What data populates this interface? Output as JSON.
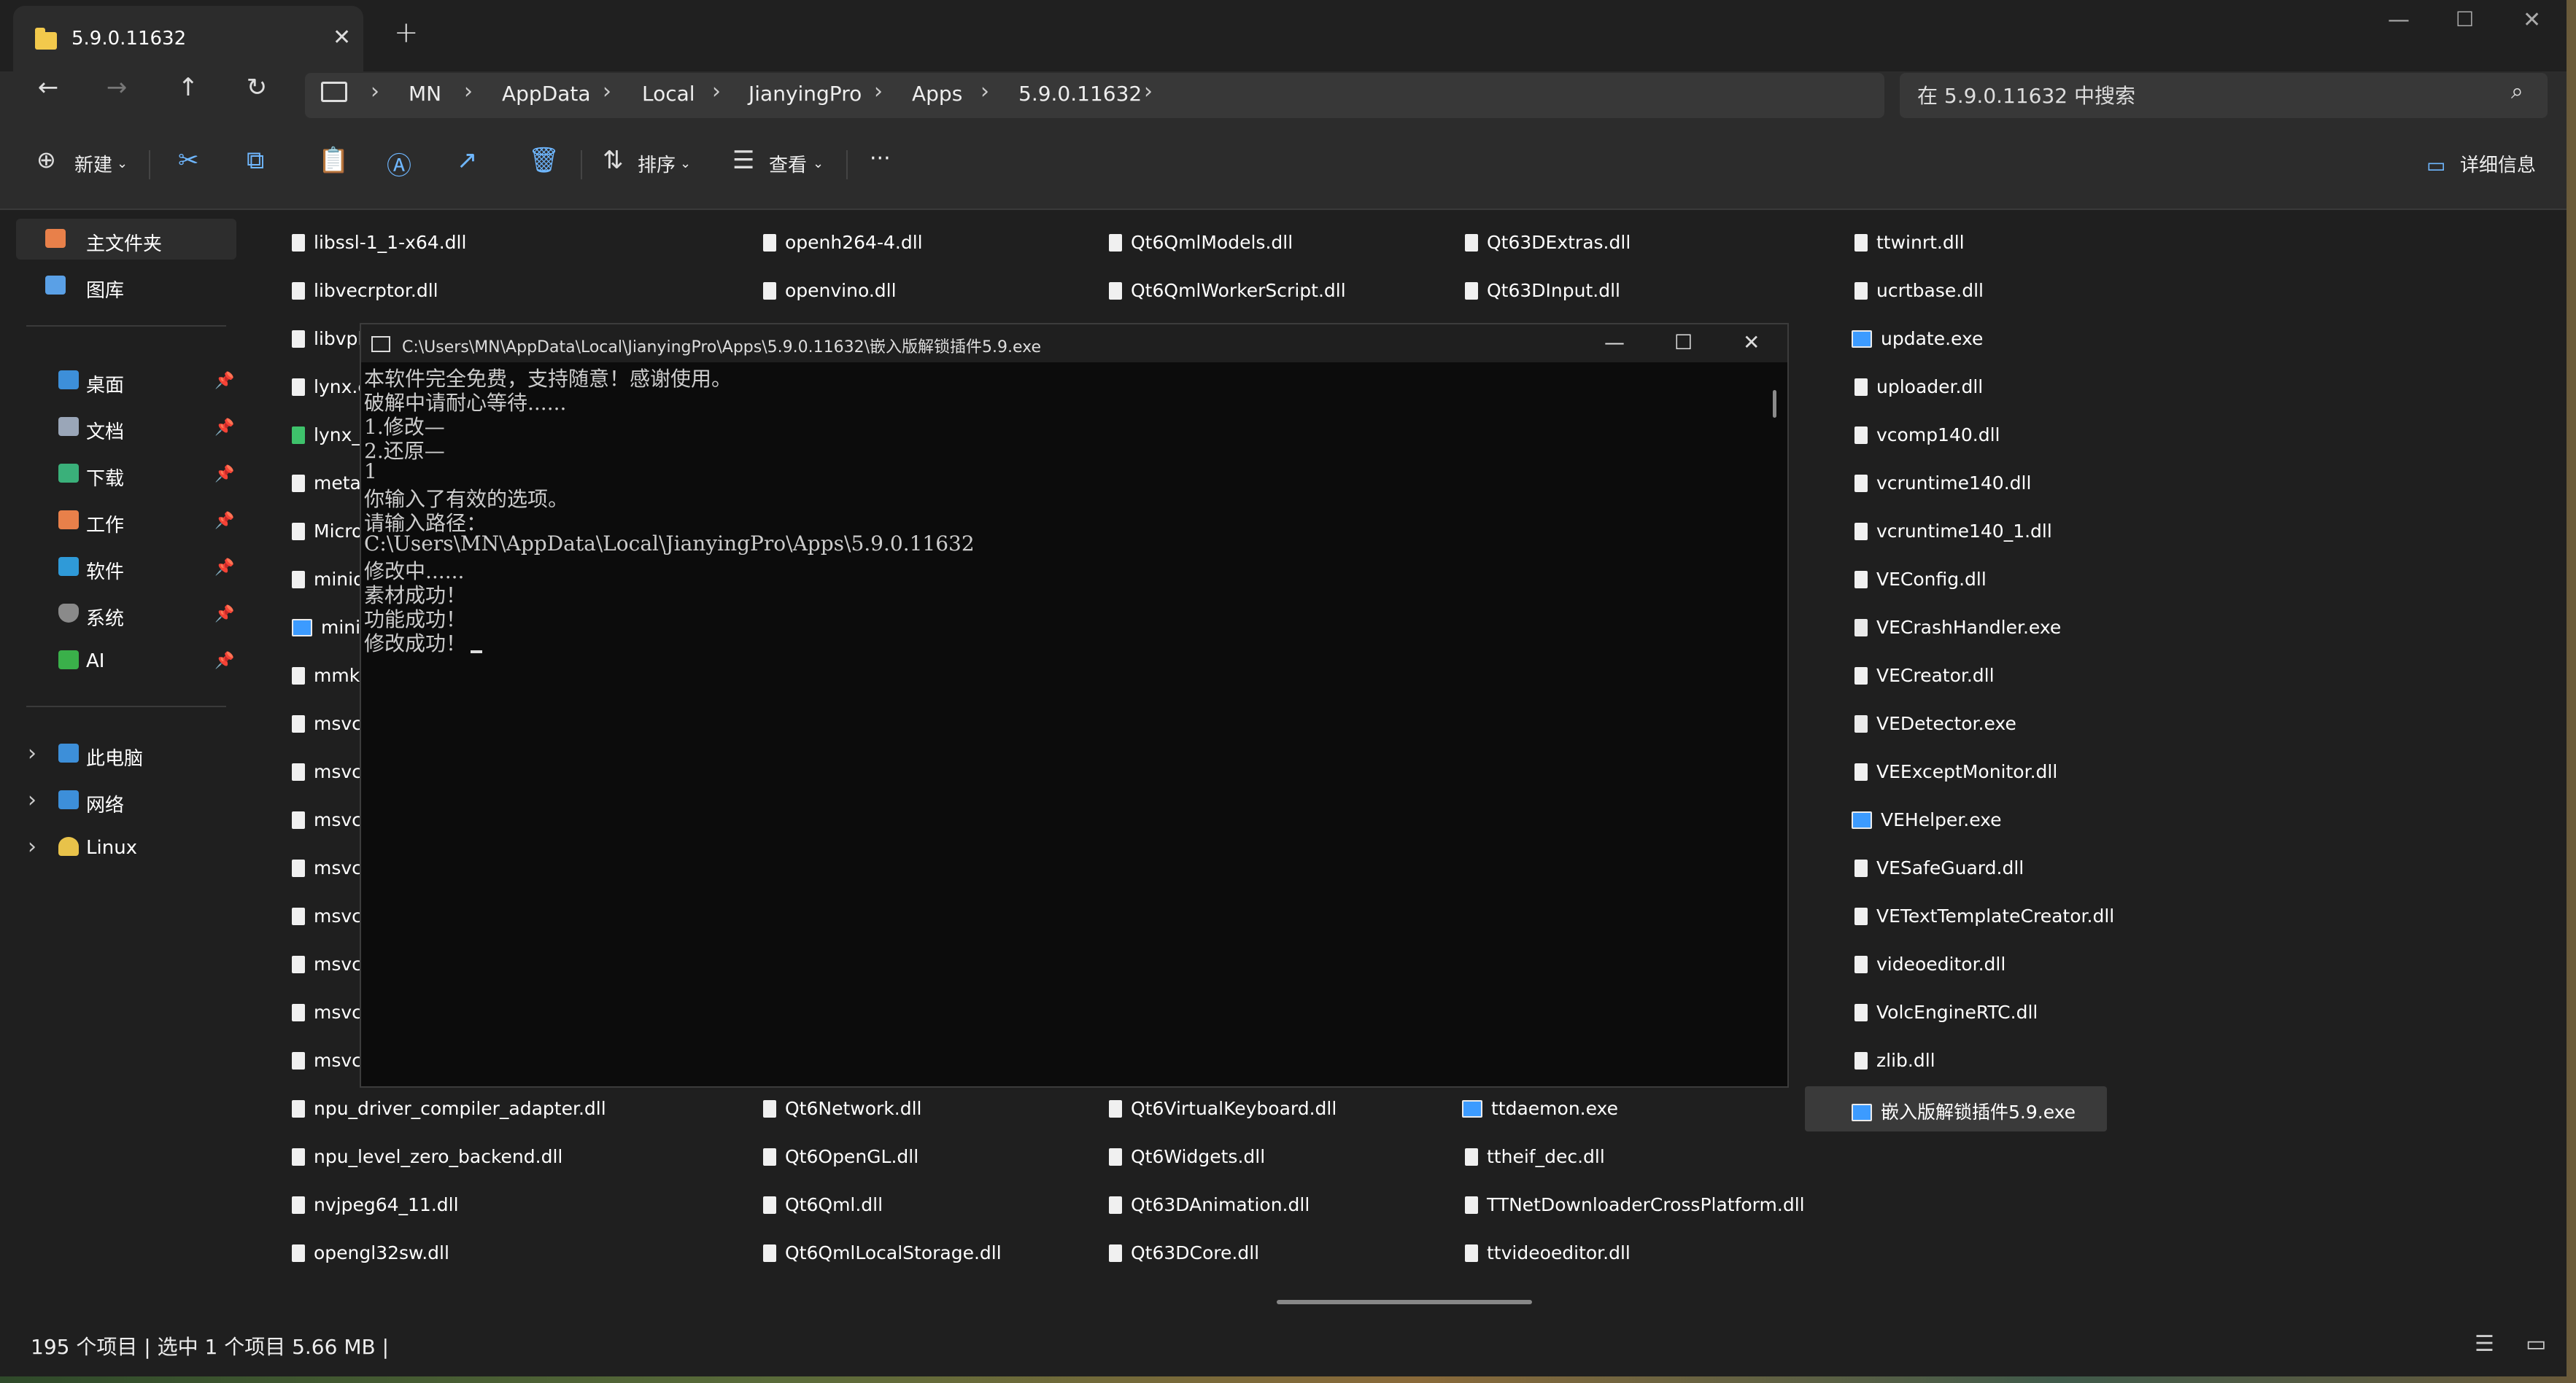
{
  "tab": {
    "title": "5.9.0.11632",
    "close": "✕",
    "new": "+"
  },
  "window_controls": {
    "minimize": "—",
    "maximize": "☐",
    "close": "✕"
  },
  "nav": {
    "back": "←",
    "forward": "→",
    "up": "↑",
    "refresh": "↻"
  },
  "breadcrumb": [
    "MN",
    "AppData",
    "Local",
    "JianyingPro",
    "Apps",
    "5.9.0.11632"
  ],
  "search": {
    "placeholder": "在 5.9.0.11632 中搜索"
  },
  "commands": {
    "new": "新建",
    "sort": "排序",
    "view": "查看",
    "more": "···",
    "details": "详细信息"
  },
  "sidebar": {
    "home": "主文件夹",
    "gallery": "图库",
    "pinned": [
      "桌面",
      "文档",
      "下载",
      "工作",
      "软件",
      "系统",
      "AI"
    ],
    "drives": [
      "此电脑",
      "网络",
      "Linux"
    ]
  },
  "files": {
    "col1": [
      "libssl-1_1-x64.dll",
      "libvecrptor.dll",
      "libvpl",
      "lynx.c",
      "lynx_",
      "meta",
      "Micro",
      "minid",
      "minid",
      "mmkv",
      "msvc",
      "msvc",
      "msvc",
      "msvc",
      "msvc",
      "msvc",
      "msvc",
      "msvc",
      "npu_driver_compiler_adapter.dll",
      "npu_level_zero_backend.dll",
      "nvjpeg64_11.dll",
      "opengl32sw.dll"
    ],
    "col2": [
      "openh264-4.dll",
      "openvino.dll",
      "Qt6Network.dll",
      "Qt6OpenGL.dll",
      "Qt6Qml.dll",
      "Qt6QmlLocalStorage.dll"
    ],
    "col3": [
      "Qt6QmlModels.dll",
      "Qt6QmlWorkerScript.dll",
      "Qt6VirtualKeyboard.dll",
      "Qt6Widgets.dll",
      "Qt63DAnimation.dll",
      "Qt63DCore.dll"
    ],
    "col4": [
      "Qt63DExtras.dll",
      "Qt63DInput.dll",
      "ttdaemon.exe",
      "ttheif_dec.dll",
      "TTNetDownloaderCrossPlatform.dll",
      "ttvideoeditor.dll"
    ],
    "col5": [
      "ttwinrt.dll",
      "ucrtbase.dll",
      "update.exe",
      "uploader.dll",
      "vcomp140.dll",
      "vcruntime140.dll",
      "vcruntime140_1.dll",
      "VEConfig.dll",
      "VECrashHandler.exe",
      "VECreator.dll",
      "VEDetector.exe",
      "VEExceptMonitor.dll",
      "VEHelper.exe",
      "VESafeGuard.dll",
      "VETextTemplateCreator.dll",
      "videoeditor.dll",
      "VolcEngineRTC.dll",
      "zlib.dll",
      "嵌入版解锁插件5.9.exe"
    ]
  },
  "status": {
    "text": "195 个项目  |  选中 1 个项目  5.66 MB  |"
  },
  "console": {
    "title": "C:\\Users\\MN\\AppData\\Local\\JianyingPro\\Apps\\5.9.0.11632\\嵌入版解锁插件5.9.exe",
    "lines": [
      "本软件完全免费，支持随意！感谢使用。",
      "破解中请耐心等待......",
      "1.修改—",
      "2.还原—",
      "1",
      "你输入了有效的选项。",
      "请输入路径：",
      "C:\\Users\\MN\\AppData\\Local\\JianyingPro\\Apps\\5.9.0.11632",
      "修改中......",
      "素材成功！",
      "功能成功！",
      "修改成功！"
    ]
  }
}
